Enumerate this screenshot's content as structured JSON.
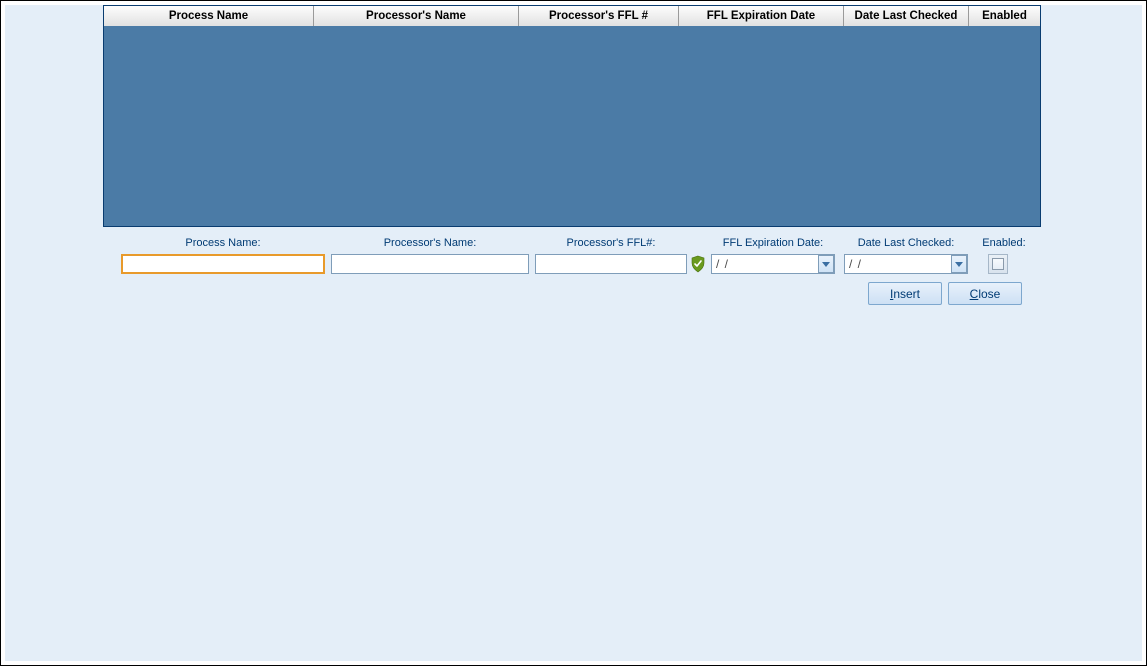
{
  "grid": {
    "columns": {
      "process_name": "Process Name",
      "processor_name": "Processor's Name",
      "ffl": "Processor's FFL #",
      "exp": "FFL Expiration Date",
      "checked": "Date Last Checked",
      "enabled": "Enabled"
    },
    "rows": []
  },
  "form": {
    "labels": {
      "process_name": "Process Name:",
      "processor_name": "Processor's Name:",
      "ffl": "Processor's FFL#:",
      "exp": "FFL Expiration Date:",
      "checked": "Date Last Checked:",
      "enabled": "Enabled:"
    },
    "values": {
      "process_name": "",
      "processor_name": "",
      "ffl": "",
      "exp": "  /  /",
      "checked": "  /  /",
      "enabled": false
    }
  },
  "buttons": {
    "insert": {
      "underline": "I",
      "rest": "nsert"
    },
    "close": {
      "underline": "C",
      "rest": "lose"
    }
  }
}
